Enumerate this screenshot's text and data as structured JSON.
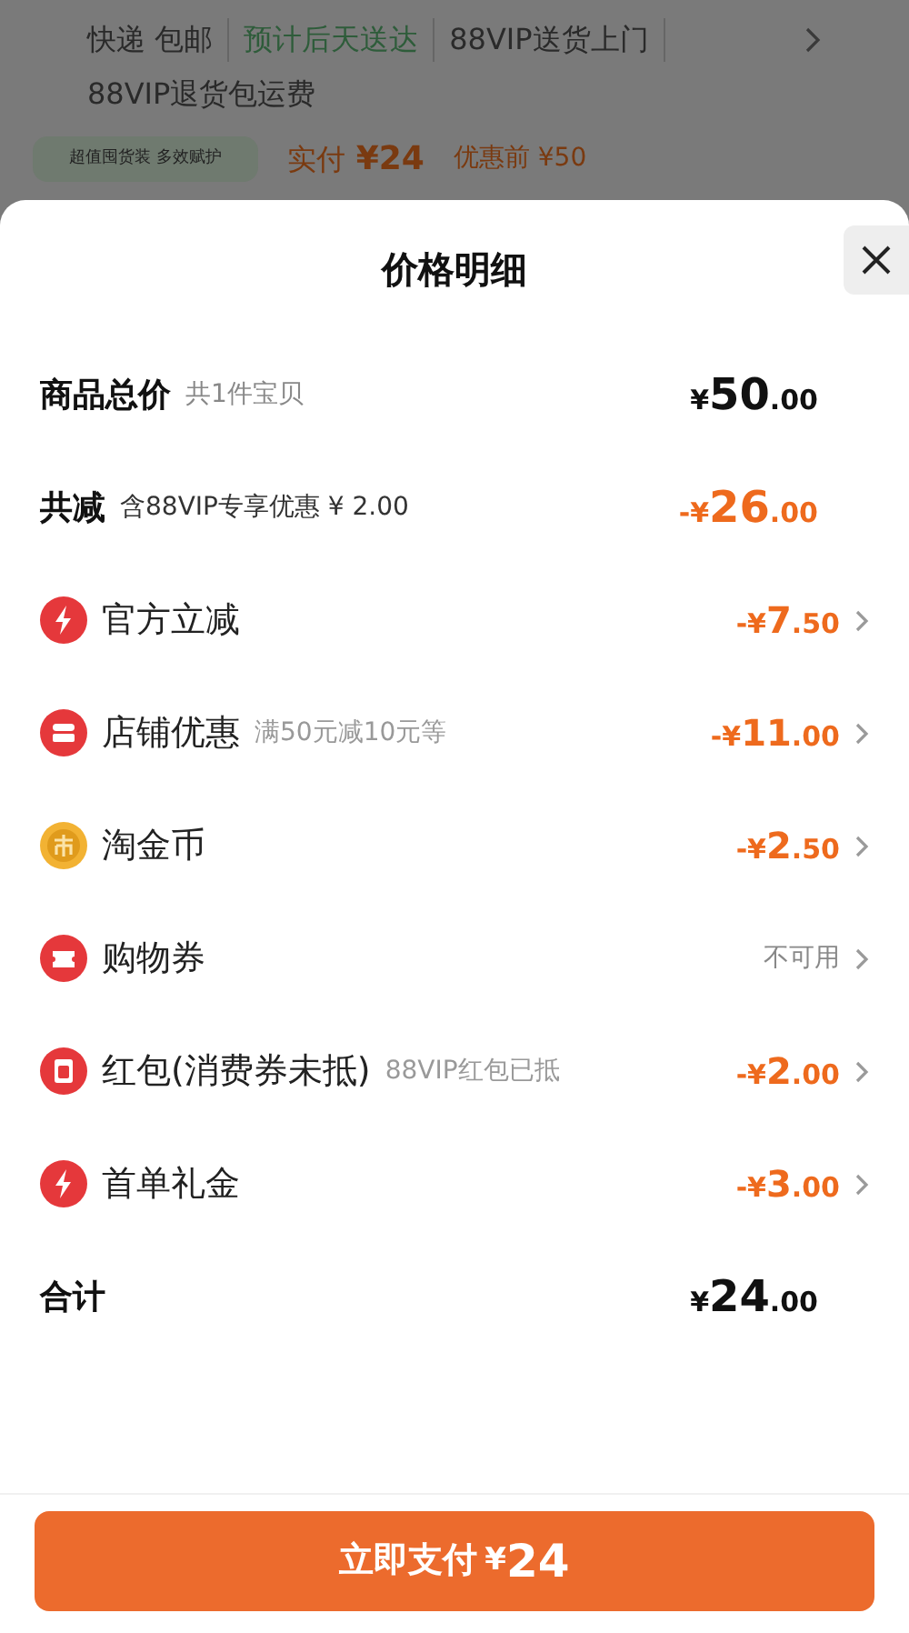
{
  "background": {
    "delivery_tags": [
      {
        "label": "快递 包邮",
        "kind": "plain"
      },
      {
        "label": "预计后天送达",
        "kind": "green"
      },
      {
        "label": "88VIP送货上门",
        "kind": "plain"
      },
      {
        "label": "88VIP退货包运费",
        "kind": "plain"
      }
    ],
    "badge": "超值囤货装 多效赋护",
    "paid_label": "实付",
    "paid_amount": "¥24",
    "before_label": "优惠前 ¥50"
  },
  "sheet": {
    "title": "价格明细",
    "summary_rows": [
      {
        "label": "商品总价",
        "note": "共1件宝贝",
        "sign": "¥",
        "int": "50",
        "dec": ".00",
        "highlight": false
      },
      {
        "label": "共减",
        "note": "含88VIP专享优惠 ¥ 2.00",
        "sign": "-¥",
        "int": "26",
        "dec": ".00",
        "highlight": true
      }
    ],
    "items": [
      {
        "kind": "bolt",
        "label": "官方立减",
        "sign": "-¥",
        "int": "7",
        "dec": ".50"
      },
      {
        "kind": "store",
        "label": "店铺优惠",
        "note": "满50元减10元等",
        "sign": "-¥",
        "int": "11",
        "dec": ".00"
      },
      {
        "kind": "coin",
        "label": "淘金币",
        "sign": "-¥",
        "int": "2",
        "dec": ".50"
      },
      {
        "kind": "ticket",
        "label": "购物券",
        "status": "不可用"
      },
      {
        "kind": "packet",
        "label": "红包(消费券未抵)",
        "note": "88VIP红包已抵",
        "sign": "-¥",
        "int": "2",
        "dec": ".00"
      },
      {
        "kind": "bolt",
        "label": "首单礼金",
        "sign": "-¥",
        "int": "3",
        "dec": ".00"
      }
    ],
    "total": {
      "label": "合计",
      "sign": "¥",
      "int": "24",
      "dec": ".00"
    },
    "pay_button": {
      "label": "立即支付",
      "sign": "¥",
      "amount": "24"
    }
  }
}
